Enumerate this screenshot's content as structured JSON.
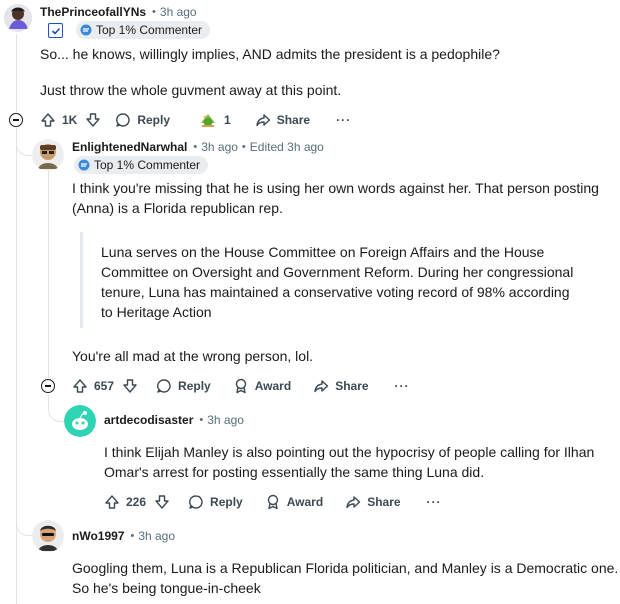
{
  "comments": [
    {
      "username": "ThePrinceofallYNs",
      "time": "3h ago",
      "badge": "Top 1% Commenter",
      "body": [
        "So... he knows, willingly implies, AND admits the president is a pedophile?",
        "Just throw the whole guvment away at this point."
      ],
      "votes": "1K",
      "reply_label": "Reply",
      "award_count": "1",
      "share_label": "Share",
      "more_label": "···"
    },
    {
      "username": "EnlightenedNarwhal",
      "time": "3h ago",
      "edited": "Edited 3h ago",
      "badge": "Top 1% Commenter",
      "body_lines": [
        "I think you're missing that he is using her own words against her. That person posting",
        "(Anna) is a Florida republican rep."
      ],
      "quote_lines": [
        "Luna serves on the House Committee on Foreign Affairs and the House",
        "Committee on Oversight and Government Reform. During her congressional",
        "tenure, Luna has maintained a conservative voting record of 98% according",
        "to Heritage Action"
      ],
      "closing": "You're all mad at the wrong person, lol.",
      "votes": "657",
      "reply_label": "Reply",
      "award_label": "Award",
      "share_label": "Share",
      "more_label": "···"
    },
    {
      "username": "artdecodisaster",
      "time": "3h ago",
      "body_lines": [
        "I think Elijah Manley is also pointing out the hypocrisy of people calling for Ilhan",
        "Omar's arrest for posting essentially the same thing Luna did."
      ],
      "votes": "226",
      "reply_label": "Reply",
      "award_label": "Award",
      "share_label": "Share",
      "more_label": "···"
    },
    {
      "username": "nWo1997",
      "time": "3h ago",
      "body_lines": [
        "Googling them, Luna is a Republican Florida politician, and Manley is a Democratic one.",
        "So he's being tongue-in-cheek"
      ]
    }
  ],
  "colors": {
    "text": "#1a1a1b",
    "meta": "#576f76",
    "thread": "#e0e4e7",
    "badge_bg": "#eaedef",
    "snoo_teal": "#2fd4b4",
    "checkbox_blue": "#1a4fbf"
  },
  "icons": [
    "upvote-icon",
    "downvote-icon",
    "comment-icon",
    "share-icon",
    "award-icon",
    "collapse-icon",
    "commenter-badge-icon",
    "checkbox-icon"
  ]
}
